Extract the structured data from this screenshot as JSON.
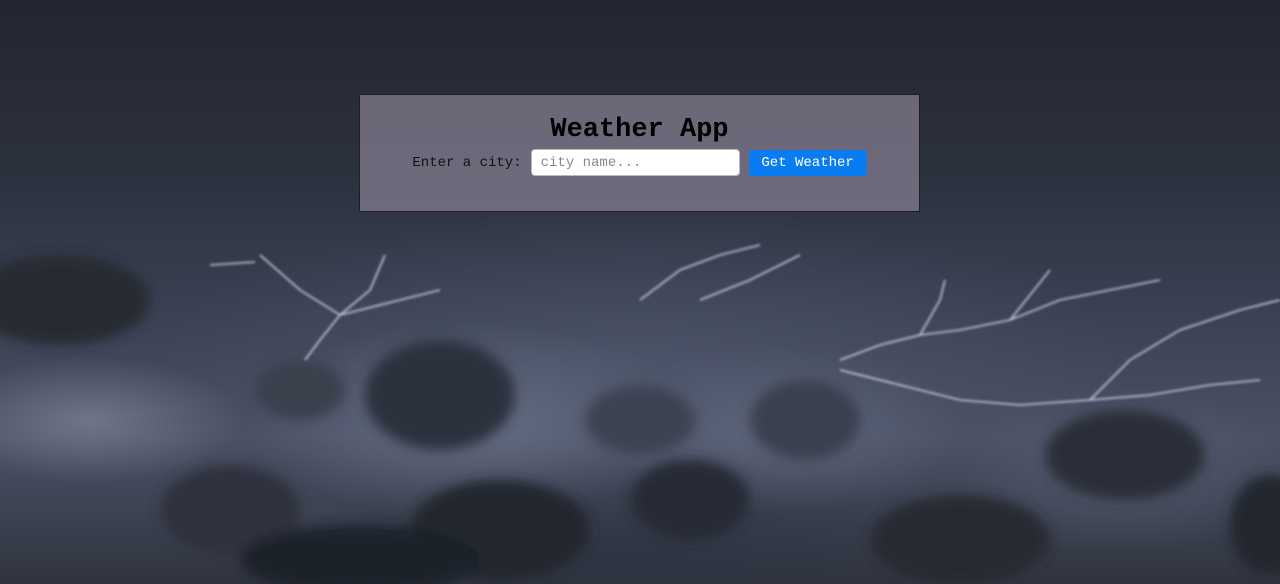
{
  "app": {
    "title": "Weather App"
  },
  "form": {
    "label": "Enter a city:",
    "input_placeholder": "city name...",
    "input_value": "",
    "button_label": "Get Weather"
  },
  "colors": {
    "button_bg": "#0a7cf2",
    "panel_bg": "rgba(150,140,160,0.62)",
    "panel_border": "#1e1e24"
  }
}
